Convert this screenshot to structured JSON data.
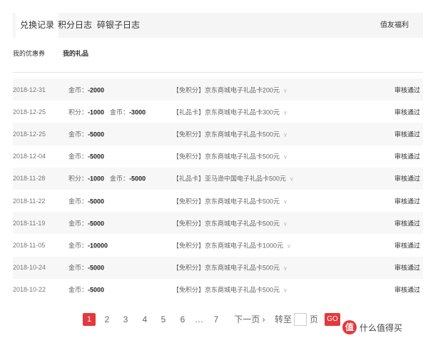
{
  "tabs": [
    {
      "label": "兑换记录",
      "active": true
    },
    {
      "label": "积分日志",
      "active": false
    },
    {
      "label": "碎银子日志",
      "active": false
    }
  ],
  "tab_right": "值友福利",
  "subtabs": [
    {
      "label": "我的优惠券",
      "active": false
    },
    {
      "label": "我的礼品",
      "active": true
    }
  ],
  "rows": [
    {
      "date": "2018-12-31",
      "amounts": [
        {
          "label": "金币：",
          "value": "-2000"
        }
      ],
      "item": "【免积分】京东商城电子礼品卡200元",
      "status": "审核通过"
    },
    {
      "date": "2018-12-25",
      "amounts": [
        {
          "label": "积分：",
          "value": "-1000"
        },
        {
          "label": "金币：",
          "value": "-3000"
        }
      ],
      "item": "【礼品卡】京东商城电子礼品卡300元",
      "status": "审核通过"
    },
    {
      "date": "2018-12-25",
      "amounts": [
        {
          "label": "金币：",
          "value": "-5000"
        }
      ],
      "item": "【免积分】京东商城电子礼品卡500元",
      "status": "审核通过"
    },
    {
      "date": "2018-12-04",
      "amounts": [
        {
          "label": "金币：",
          "value": "-5000"
        }
      ],
      "item": "【免积分】京东商城电子礼品卡500元",
      "status": "审核通过"
    },
    {
      "date": "2018-11-28",
      "amounts": [
        {
          "label": "积分：",
          "value": "-1000"
        },
        {
          "label": "金币：",
          "value": "-5000"
        }
      ],
      "item": "【礼品卡】亚马逊中国电子礼品卡500元",
      "status": "审核通过"
    },
    {
      "date": "2018-11-22",
      "amounts": [
        {
          "label": "金币：",
          "value": "-5000"
        }
      ],
      "item": "【免积分】京东商城电子礼品卡500元",
      "status": "审核通过"
    },
    {
      "date": "2018-11-19",
      "amounts": [
        {
          "label": "金币：",
          "value": "-5000"
        }
      ],
      "item": "【免积分】京东商城电子礼品卡500元",
      "status": "审核通过"
    },
    {
      "date": "2018-11-05",
      "amounts": [
        {
          "label": "金币：",
          "value": "-10000"
        }
      ],
      "item": "【免积分】京东商城电子礼品卡1000元",
      "status": "审核通过"
    },
    {
      "date": "2018-10-24",
      "amounts": [
        {
          "label": "金币：",
          "value": "-5000"
        }
      ],
      "item": "【免积分】京东商城电子礼品卡500元",
      "status": "审核通过"
    },
    {
      "date": "2018-10-22",
      "amounts": [
        {
          "label": "金币：",
          "value": "-5000"
        }
      ],
      "item": "【免积分】京东商城电子礼品卡500元",
      "status": "审核通过"
    }
  ],
  "pagination": {
    "pages": [
      "1",
      "2",
      "3",
      "4",
      "5",
      "6"
    ],
    "current": "1",
    "ellipsis": "…",
    "last": "7",
    "next_label": "下一页 ›",
    "goto_label": "转至",
    "page_unit": "页",
    "go_label": "GO"
  },
  "watermark": {
    "logo": "值",
    "text": "什么值得买"
  },
  "colors": {
    "accent": "#e4393c",
    "row_shade": "#f7f7f7",
    "tab_bg": "#f5f5f5"
  }
}
